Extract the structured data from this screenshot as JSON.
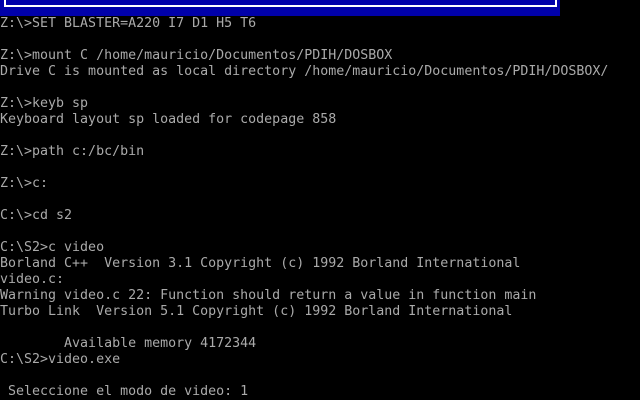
{
  "banner": {
    "background": "#0000aa",
    "frame_color": "#ffffff"
  },
  "console": {
    "foreground": "#aaaaaa",
    "background": "#000000",
    "lines": [
      "Z:\\>SET BLASTER=A220 I7 D1 H5 T6",
      "",
      "Z:\\>mount C /home/mauricio/Documentos/PDIH/DOSBOX",
      "Drive C is mounted as local directory /home/mauricio/Documentos/PDIH/DOSBOX/",
      "",
      "Z:\\>keyb sp",
      "Keyboard layout sp loaded for codepage 858",
      "",
      "Z:\\>path c:/bc/bin",
      "",
      "Z:\\>c:",
      "",
      "C:\\>cd s2",
      "",
      "C:\\S2>c video",
      "Borland C++  Version 3.1 Copyright (c) 1992 Borland International",
      "video.c:",
      "Warning video.c 22: Function should return a value in function main",
      "Turbo Link  Version 5.1 Copyright (c) 1992 Borland International",
      "",
      "        Available memory 4172344",
      "C:\\S2>video.exe",
      "",
      " Seleccione el modo de video: 1"
    ]
  }
}
